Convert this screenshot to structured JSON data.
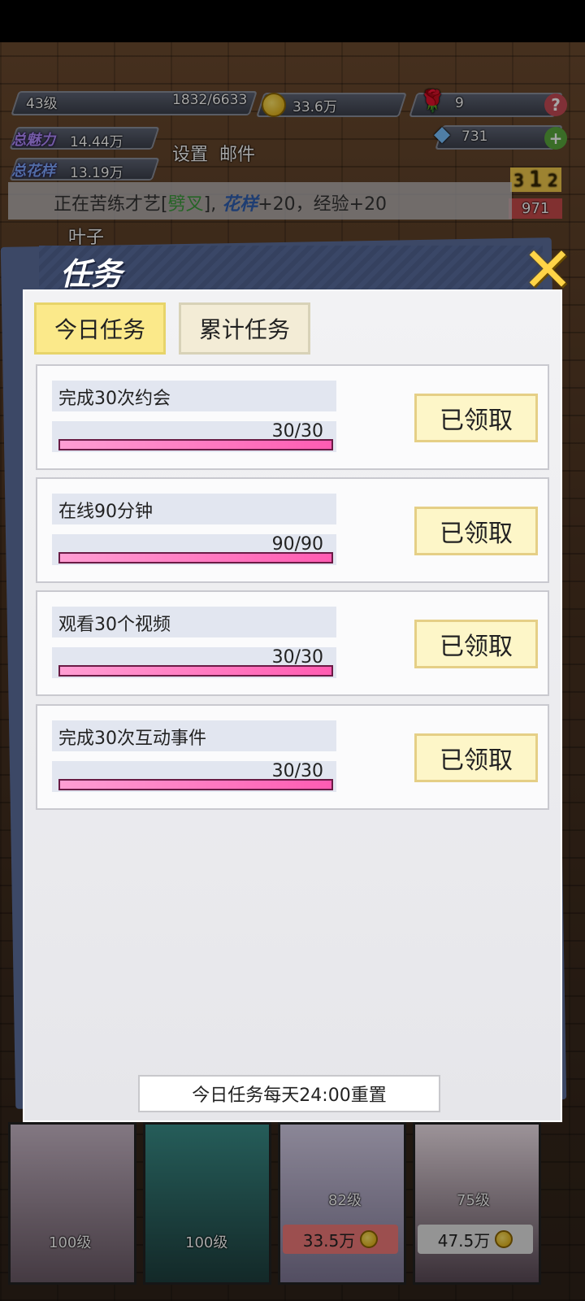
{
  "hud": {
    "level": "43级",
    "exp": "1832/6633",
    "exp_fraction": 0.276,
    "gold": "33.6万",
    "roses": "9",
    "diamonds": "731",
    "charm_label": "总魅力",
    "charm_value": "14.44万",
    "style_label": "总花样",
    "style_value": "13.19万",
    "settings_label": "设置",
    "mail_label": "邮件",
    "help_icon": "?",
    "add_icon": "+",
    "rank_digits": [
      "3",
      "1",
      "2"
    ],
    "rank_score": "971"
  },
  "ticker": {
    "prefix": "正在苦练才艺[",
    "skill": "劈叉",
    "middle": "],",
    "stat": "花样",
    "suffix": "+20，经验+20"
  },
  "behind": {
    "character_name": "叶子"
  },
  "modal": {
    "title": "任务",
    "tabs": [
      "今日任务",
      "累计任务"
    ],
    "active_tab": 0,
    "tasks": [
      {
        "name": "完成30次约会",
        "progress": "30/30",
        "fraction": 1.0,
        "button": "已领取"
      },
      {
        "name": "在线90分钟",
        "progress": "90/90",
        "fraction": 1.0,
        "button": "已领取"
      },
      {
        "name": "观看30个视频",
        "progress": "30/30",
        "fraction": 1.0,
        "button": "已领取"
      },
      {
        "name": "完成30次互动事件",
        "progress": "30/30",
        "fraction": 1.0,
        "button": "已领取"
      }
    ],
    "reset_note": "今日任务每天24:00重置",
    "close_icon": "close-icon"
  },
  "cards": [
    {
      "level": "100级",
      "price": ""
    },
    {
      "level": "100级",
      "price": ""
    },
    {
      "level": "82级",
      "price": "33.5万"
    },
    {
      "level": "75级",
      "price": "47.5万"
    }
  ],
  "colors": {
    "tab_active": "#fbe98a",
    "progress_fill": "#ff5cb2",
    "claim_button": "#fdf6c8",
    "modal_header": "#3a4767",
    "close_accent": "#ffd447"
  }
}
